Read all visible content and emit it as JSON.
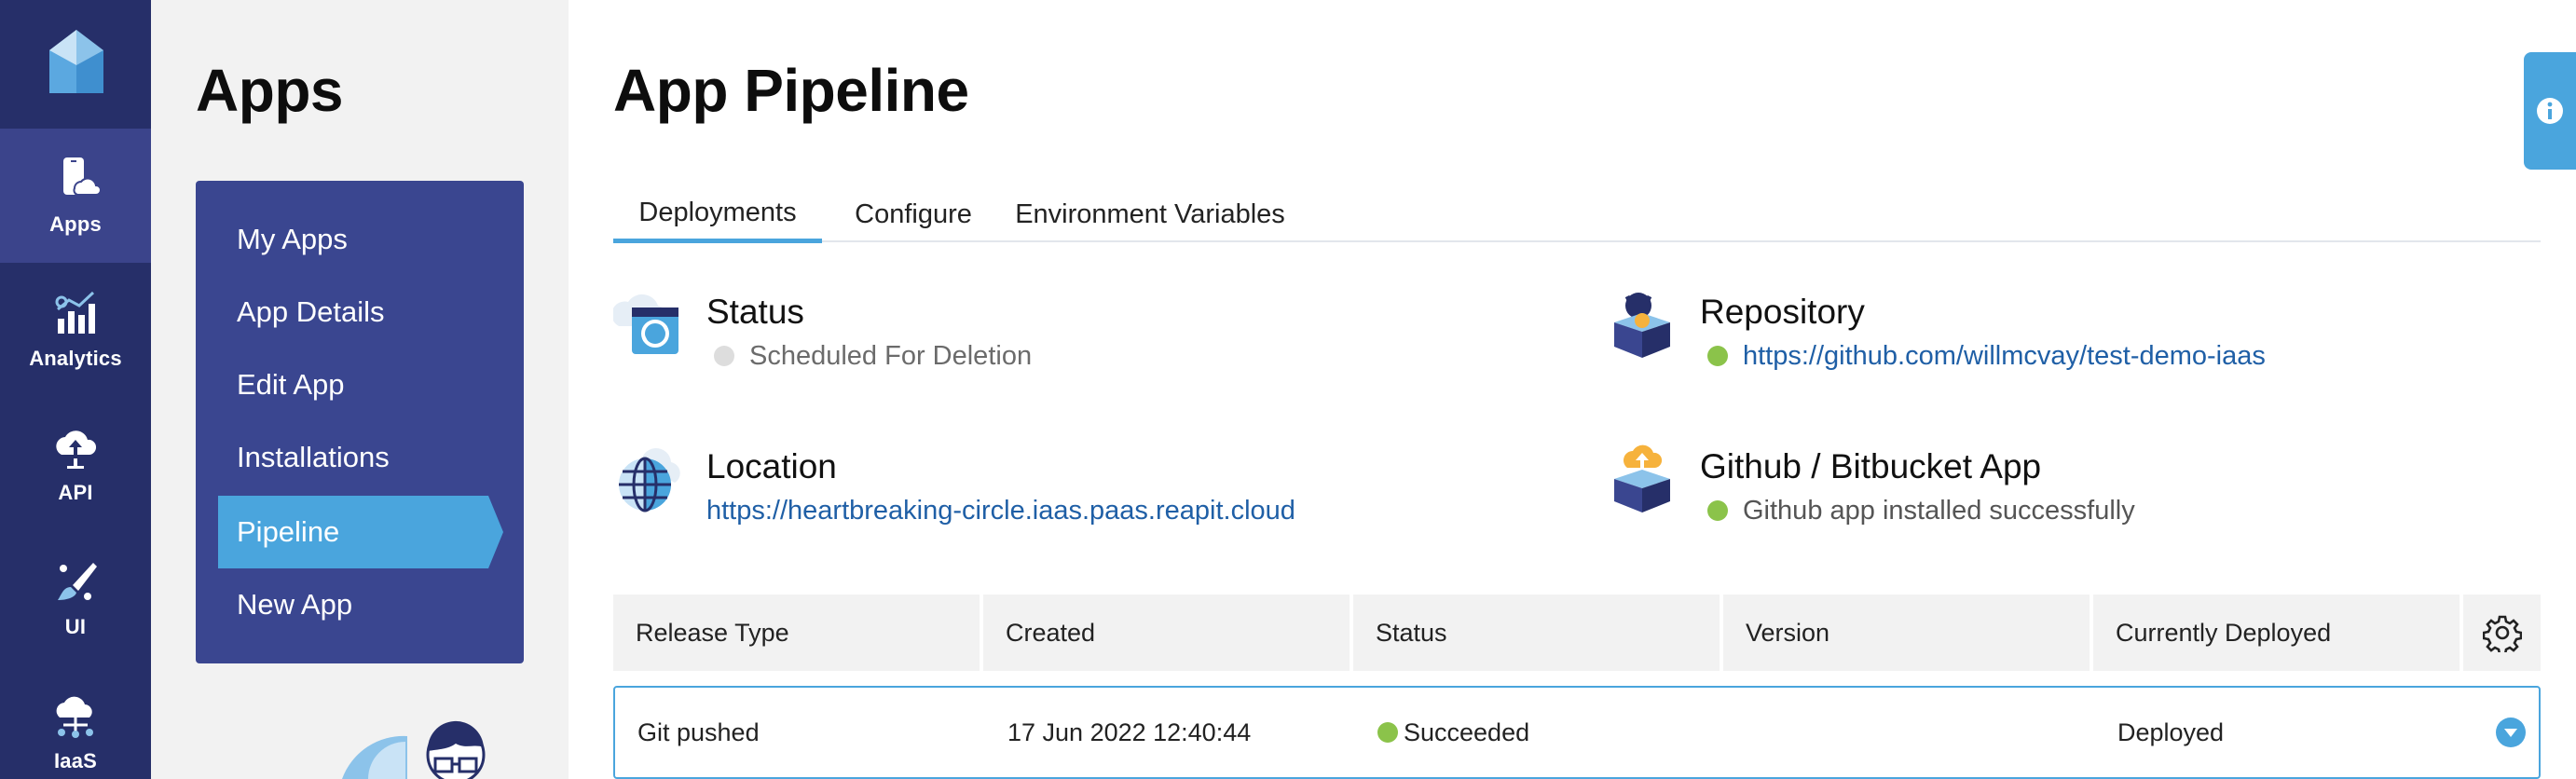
{
  "colors": {
    "rail_bg": "#262f69",
    "rail_active": "#3b448b",
    "menu_bg": "#3a4690",
    "accent": "#4aa5dd",
    "success": "#8bc34a",
    "inactive": "#dddddd",
    "link": "#1f5fa6"
  },
  "rail": {
    "logo_icon": "reapit-logo-icon",
    "items": [
      {
        "label": "Apps",
        "icon": "mobile-cloud-icon",
        "active": true
      },
      {
        "label": "Analytics",
        "icon": "bar-chart-icon",
        "active": false
      },
      {
        "label": "API",
        "icon": "cloud-upload-icon",
        "active": false
      },
      {
        "label": "UI",
        "icon": "paintbrush-icon",
        "active": false
      },
      {
        "label": "IaaS",
        "icon": "cloud-network-icon",
        "active": false
      }
    ]
  },
  "subnav": {
    "title": "Apps",
    "items": [
      {
        "label": "My Apps",
        "active": false
      },
      {
        "label": "App Details",
        "active": false
      },
      {
        "label": "Edit App",
        "active": false
      },
      {
        "label": "Installations",
        "active": false
      },
      {
        "label": "Pipeline",
        "active": true
      },
      {
        "label": "New App",
        "active": false
      }
    ]
  },
  "main": {
    "title": "App Pipeline",
    "tabs": [
      {
        "label": "Deployments",
        "active": true
      },
      {
        "label": "Configure",
        "active": false
      },
      {
        "label": "Environment Variables",
        "active": false
      }
    ],
    "status": {
      "title": "Status",
      "value": "Scheduled For Deletion",
      "icon": "cloud-refresh-icon"
    },
    "repository": {
      "title": "Repository",
      "value": "https://github.com/willmcvay/test-demo-iaas",
      "icon": "github-box-icon"
    },
    "location": {
      "title": "Location",
      "value": "https://heartbreaking-circle.iaas.paas.reapit.cloud",
      "icon": "globe-icon"
    },
    "github_app": {
      "title": "Github / Bitbucket App",
      "value": "Github app installed successfully",
      "icon": "cloud-box-icon"
    },
    "table": {
      "columns": [
        "Release Type",
        "Created",
        "Status",
        "Version",
        "Currently Deployed"
      ],
      "rows": [
        {
          "release_type": "Git pushed",
          "created": "17 Jun 2022 12:40:44",
          "status": "Succeeded",
          "version": "",
          "currently_deployed": "Deployed"
        }
      ]
    }
  }
}
